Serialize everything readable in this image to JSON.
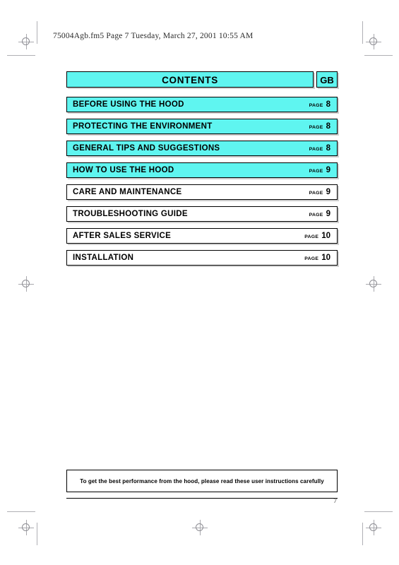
{
  "header": {
    "file_line": "75004Agb.fm5  Page 7  Tuesday, March 27, 2001  10:55 AM"
  },
  "contents": {
    "title": "CONTENTS",
    "language_code": "GB",
    "page_word": "PAGE",
    "rows": [
      {
        "label": "BEFORE USING THE HOOD",
        "page": "8",
        "style": "cyan"
      },
      {
        "label": "PROTECTING THE ENVIRONMENT",
        "page": "8",
        "style": "cyan"
      },
      {
        "label": "GENERAL TIPS AND SUGGESTIONS",
        "page": "8",
        "style": "cyan"
      },
      {
        "label": "HOW TO USE THE HOOD",
        "page": "9",
        "style": "cyan"
      },
      {
        "label": "CARE AND MAINTENANCE",
        "page": "9",
        "style": "plain"
      },
      {
        "label": "TROUBLESHOOTING GUIDE",
        "page": "9",
        "style": "plain"
      },
      {
        "label": "AFTER SALES SERVICE",
        "page": "10",
        "style": "plain"
      },
      {
        "label": "INSTALLATION",
        "page": "10",
        "style": "plain"
      }
    ]
  },
  "footer": {
    "note": "To get the best performance from the hood, please read these user instructions carefully",
    "page_number": "7"
  },
  "colors": {
    "highlight": "#5ff5f0",
    "border": "#000000",
    "text": "#000000",
    "registration_mark": "#8d8d93"
  }
}
